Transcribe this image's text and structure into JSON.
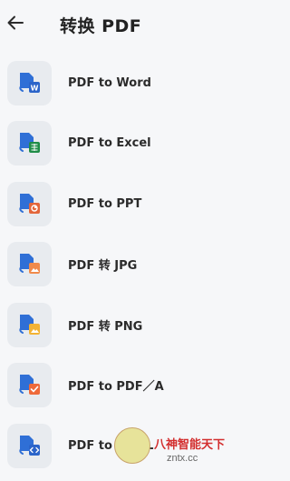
{
  "header": {
    "title": "转换 PDF"
  },
  "items": [
    {
      "label": "PDF to Word",
      "badge_color": "#2b64c9",
      "icon": "word-doc-icon"
    },
    {
      "label": "PDF to Excel",
      "badge_color": "#1f8c47",
      "icon": "excel-sheet-icon"
    },
    {
      "label": "PDF to PPT",
      "badge_color": "#e3663b",
      "icon": "ppt-slide-icon"
    },
    {
      "label": "PDF 转 JPG",
      "badge_color": "#f08a4b",
      "icon": "jpg-image-icon"
    },
    {
      "label": "PDF 转 PNG",
      "badge_color": "#f3b335",
      "icon": "png-image-icon"
    },
    {
      "label": "PDF to PDF／A",
      "badge_color": "#ef6a3a",
      "icon": "pdfa-check-icon"
    },
    {
      "label": "PDF to HTML",
      "badge_color": "#2b64c9",
      "icon": "html-code-icon"
    }
  ],
  "watermark": {
    "text": "八神智能天下",
    "sub": "zntx.cc"
  }
}
